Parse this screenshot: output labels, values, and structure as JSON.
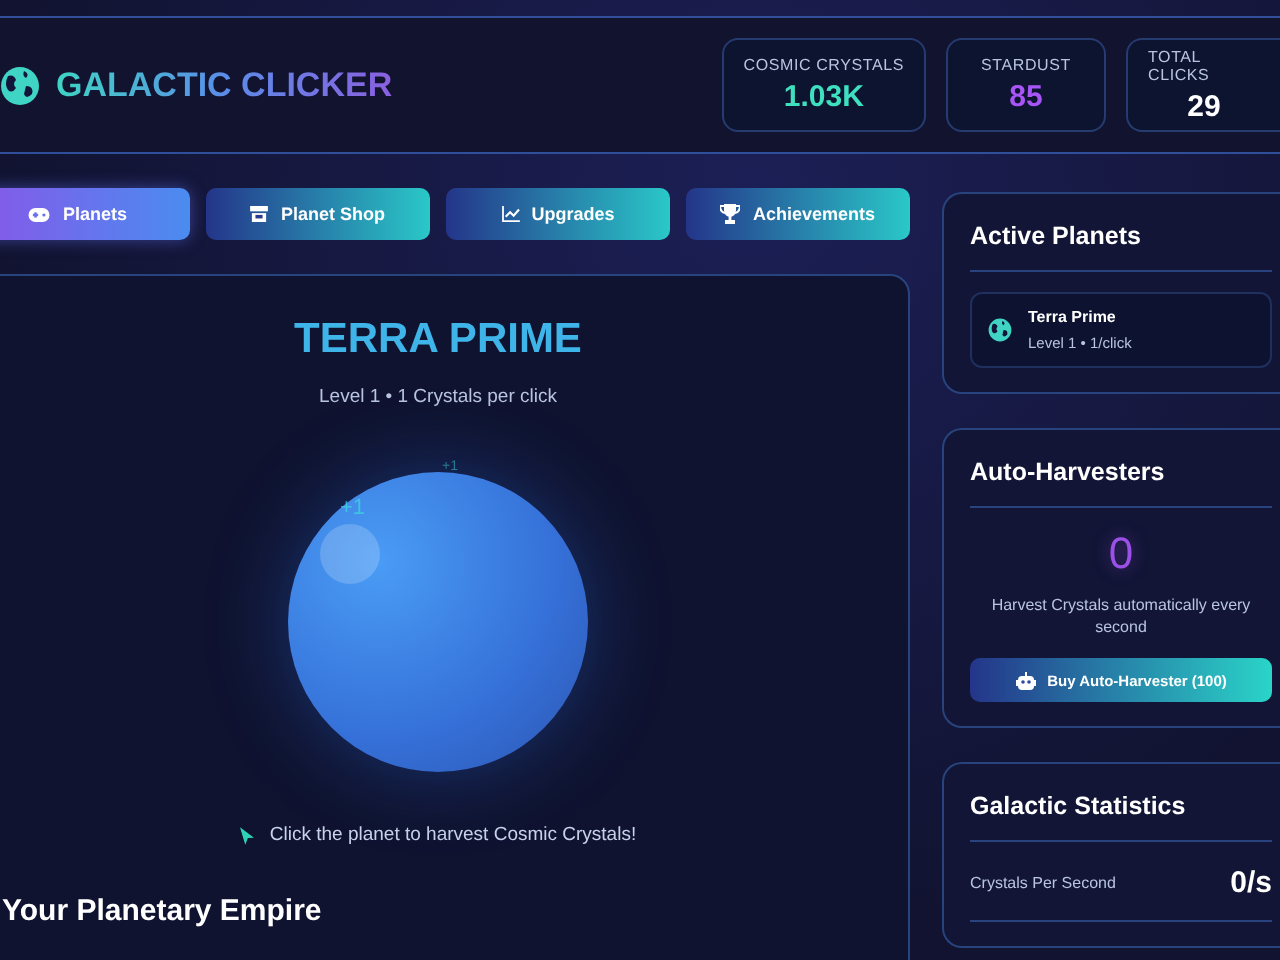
{
  "header": {
    "title": "GALACTIC CLICKER",
    "stats": [
      {
        "label": "COSMIC CRYSTALS",
        "value": "1.03K",
        "color": "#3fe0c0"
      },
      {
        "label": "STARDUST",
        "value": "85",
        "color": "#a855f7"
      },
      {
        "label": "TOTAL CLICKS",
        "value": "29",
        "color": "#ffffff"
      }
    ]
  },
  "tabs": [
    {
      "label": "Planets",
      "selected": true
    },
    {
      "label": "Planet Shop",
      "selected": false
    },
    {
      "label": "Upgrades",
      "selected": false
    },
    {
      "label": "Achievements",
      "selected": false
    }
  ],
  "planet": {
    "name": "TERRA PRIME",
    "subtitle": "Level 1 • 1 Crystals per click",
    "popups": [
      "+1",
      "+1"
    ],
    "hint": "Click the planet to harvest Cosmic Crystals!"
  },
  "empire": {
    "title": "Your Planetary Empire"
  },
  "active_planets": {
    "title": "Active Planets",
    "items": [
      {
        "name": "Terra Prime",
        "detail": "Level 1 • 1/click"
      }
    ]
  },
  "auto_harvesters": {
    "title": "Auto-Harvesters",
    "count": "0",
    "description": "Harvest Crystals automatically every second",
    "button": "Buy Auto-Harvester (100)"
  },
  "statistics": {
    "title": "Galactic Statistics",
    "rows": [
      {
        "label": "Crystals Per Second",
        "value": "0/s"
      }
    ]
  }
}
